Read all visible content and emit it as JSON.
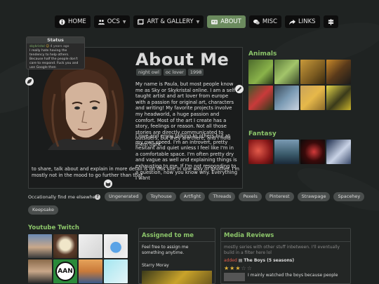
{
  "nav": {
    "home": "HOME",
    "ocs": "OCS",
    "art_gallery": "ART & GALLERY",
    "about": "ABOUT",
    "misc": "MISC",
    "links": "LINKS"
  },
  "status": {
    "title": "Status",
    "user": "skykristal",
    "time": "4 years ago",
    "text": "I really hate having the tendency to help others. Because half the people don't care to respond. Fuck you and use Google then"
  },
  "about": {
    "title": "About Me",
    "tags": [
      "night owl",
      "oc lover",
      "1998"
    ],
    "para1": "My name is Paula, but most people know me as Sky or Skykristal online. I am a self taught artist and art lover from europe with a passion for original art, characters and writing! My favorite projects involve my headworld, a huge passion and comfort. Most of the art I create has a story, feelings or reason. Not all those stories are directly communicated to outsiders, but they are there, and I hold them tight.",
    "para2": "I love and enjoy talking to others but at my own speed. I'm an introvert, pretty hesitant and quiet unless I feel like I'm in a comfortable space. I'm often pretty dry and vague as well and explaining things is exhausting to me. If I'm not responding to a question, now you know why. Everything I want",
    "para3": "to share, talk about and explain in more detail is on this site in one way or another. I'm mostly not in the mood to go further than that."
  },
  "animals": {
    "title": "Animals"
  },
  "fantasy": {
    "title": "Fantasy"
  },
  "elsewhere": {
    "label": "Occationally find me elsewhere",
    "help": "?",
    "links": [
      "Ungenerated",
      "Toyhouse",
      "Artfight",
      "Threads",
      "Pexels",
      "Pinterest",
      "Strawpage",
      "Spacehey",
      "Keepsake"
    ]
  },
  "youtube": {
    "title": "Youtube Twitch",
    "aan_label": "AAN"
  },
  "assigned": {
    "title": "Assigned to me",
    "text": "Feel free to assign me something anytime.",
    "item": "Starry Moray"
  },
  "media": {
    "title": "Media Reviews",
    "subtitle": "mostly series with other stuff inbetween. I'll eventually build in a filter here lol",
    "added": "added",
    "show": "The Boys (5 seasons)",
    "stars": 3,
    "review": "I mainly watched the boys because people"
  },
  "colors": {
    "accent": "#8cc56a",
    "active_nav": "#6b8b5e"
  }
}
